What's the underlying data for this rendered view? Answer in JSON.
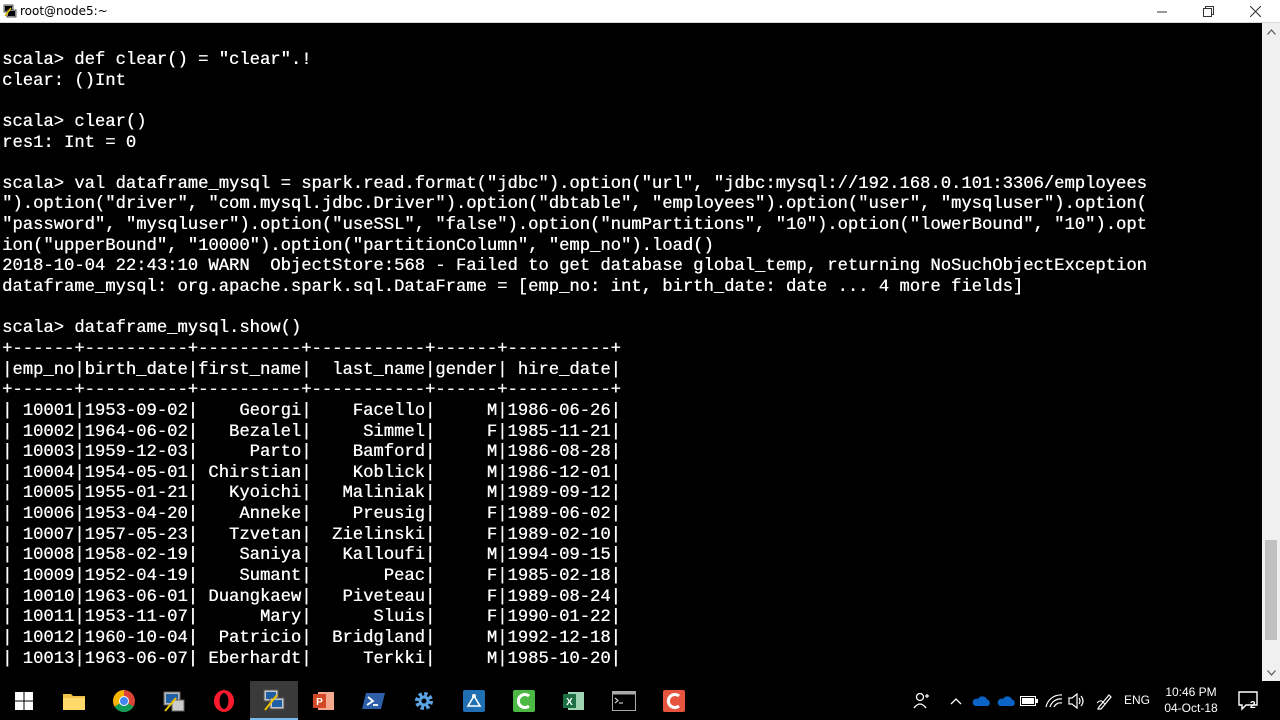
{
  "window": {
    "title": "root@node5:~"
  },
  "terminal": {
    "lines": [
      "scala> def clear() = \"clear\".!",
      "clear: ()Int",
      "",
      "scala> clear()",
      "res1: Int = 0",
      "",
      "scala> val dataframe_mysql = spark.read.format(\"jdbc\").option(\"url\", \"jdbc:mysql://192.168.0.101:3306/employees",
      "\").option(\"driver\", \"com.mysql.jdbc.Driver\").option(\"dbtable\", \"employees\").option(\"user\", \"mysqluser\").option(",
      "\"password\", \"mysqluser\").option(\"useSSL\", \"false\").option(\"numPartitions\", \"10\").option(\"lowerBound\", \"10\").opt",
      "ion(\"upperBound\", \"10000\").option(\"partitionColumn\", \"emp_no\").load()",
      "2018-10-04 22:43:10 WARN  ObjectStore:568 - Failed to get database global_temp, returning NoSuchObjectException",
      "dataframe_mysql: org.apache.spark.sql.DataFrame = [emp_no: int, birth_date: date ... 4 more fields]",
      "",
      "scala> dataframe_mysql.show()",
      "+------+----------+----------+-----------+------+----------+",
      "|emp_no|birth_date|first_name|  last_name|gender| hire_date|",
      "+------+----------+----------+-----------+------+----------+",
      "| 10001|1953-09-02|    Georgi|    Facello|     M|1986-06-26|",
      "| 10002|1964-06-02|   Bezalel|     Simmel|     F|1985-11-21|",
      "| 10003|1959-12-03|     Parto|    Bamford|     M|1986-08-28|",
      "| 10004|1954-05-01| Chirstian|    Koblick|     M|1986-12-01|",
      "| 10005|1955-01-21|   Kyoichi|   Maliniak|     M|1989-09-12|",
      "| 10006|1953-04-20|    Anneke|    Preusig|     F|1989-06-02|",
      "| 10007|1957-05-23|   Tzvetan|  Zielinski|     F|1989-02-10|",
      "| 10008|1958-02-19|    Saniya|   Kalloufi|     M|1994-09-15|",
      "| 10009|1952-04-19|    Sumant|       Peac|     F|1985-02-18|",
      "| 10010|1963-06-01| Duangkaew|   Piveteau|     F|1989-08-24|",
      "| 10011|1953-11-07|      Mary|      Sluis|     F|1990-01-22|",
      "| 10012|1960-10-04|  Patricio|  Bridgland|     M|1992-12-18|",
      "| 10013|1963-06-07| Eberhardt|     Terkki|     M|1985-10-20|"
    ]
  },
  "taskbar": {
    "apps": [
      "start",
      "file-explorer",
      "chrome",
      "putty-config",
      "opera",
      "remote-desktop",
      "powerpoint",
      "powershell",
      "settings",
      "app-blue",
      "app-green",
      "excel",
      "cmd",
      "app-red"
    ],
    "language": "ENG",
    "time": "10:46 PM",
    "date": "04-Oct-18",
    "notification_count": "2"
  }
}
